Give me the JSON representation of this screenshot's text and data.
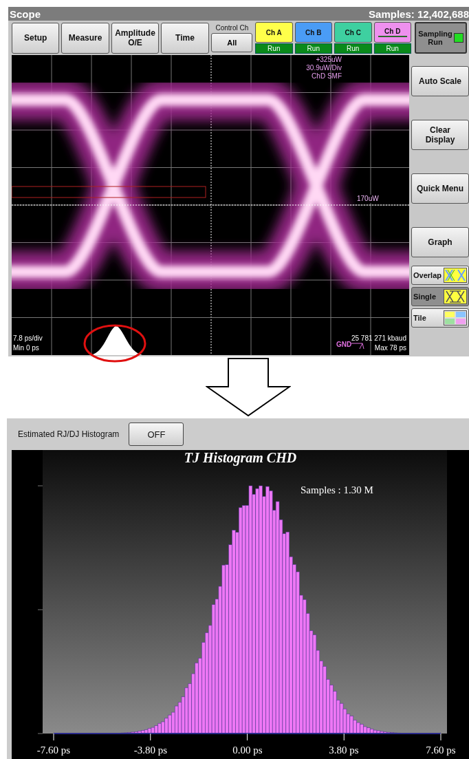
{
  "scope": {
    "title": "Scope",
    "samples": "Samples: 12,402,688",
    "menu_buttons": [
      {
        "label": "Setup"
      },
      {
        "label": "Measure"
      },
      {
        "label": "Amplitude O/E"
      },
      {
        "label": "Time"
      }
    ],
    "control_ch": {
      "label": "Control Ch",
      "button": "All"
    },
    "channels": [
      {
        "name": "Ch A",
        "color": "#ffff4a",
        "status": "Run",
        "selected": false
      },
      {
        "name": "Ch B",
        "color": "#4a9cf5",
        "status": "Run",
        "selected": false
      },
      {
        "name": "Ch C",
        "color": "#3ed0a0",
        "status": "Run",
        "selected": false
      },
      {
        "name": "Ch D",
        "color": "#ee90ee",
        "status": "Run",
        "selected": true
      }
    ],
    "sampling": {
      "label": "Sampling Run",
      "on": true
    },
    "side_buttons": [
      {
        "label": "Auto Scale"
      },
      {
        "label": "Clear Display"
      },
      {
        "label": "Quick Menu"
      },
      {
        "label": "Graph"
      }
    ],
    "view_modes": [
      {
        "label": "Overlap",
        "kind": "overlap",
        "selected": false
      },
      {
        "label": "Single",
        "kind": "single",
        "selected": true
      },
      {
        "label": "Tile",
        "kind": "tile",
        "selected": false
      }
    ],
    "scale_lines": [
      "+325uW",
      "30.9uW/Div",
      "ChD SMF"
    ],
    "marker_level": "170uW",
    "time_scale": "7.8 ps/div",
    "min_time": "Min 0 ps",
    "bitrate": "25 781 271 kbaud",
    "max_time": "Max 78 ps",
    "ground": "GND"
  },
  "histogram_panel": {
    "label": "Estimated RJ/DJ Histogram",
    "button": "OFF",
    "title": "TJ Histogram CHD",
    "samples": "Samples : 1.30 M",
    "x_ticks": [
      "-7.60 ps",
      "-3.80 ps",
      "0.00 ps",
      "3.80 ps",
      "7.60 ps"
    ]
  }
}
